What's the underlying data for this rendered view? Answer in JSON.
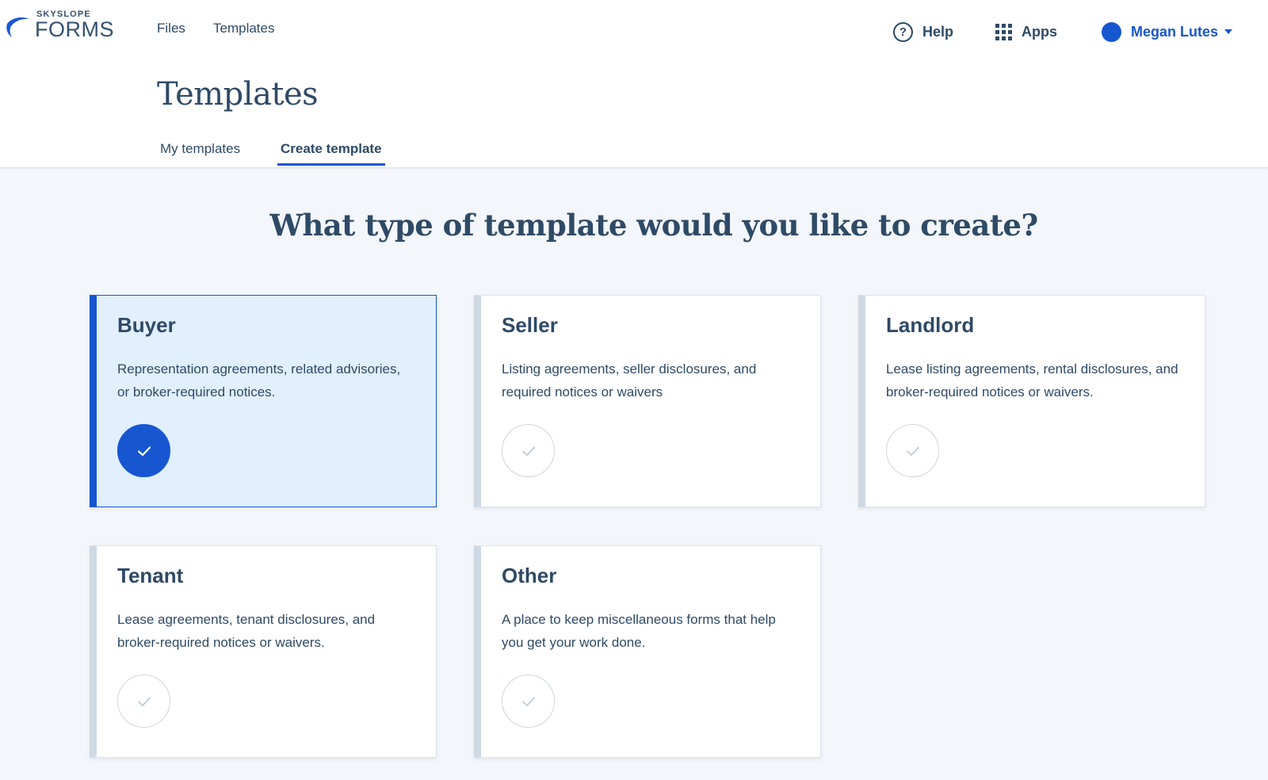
{
  "header": {
    "logo_small": "SKYSLOPE",
    "logo_big": "FORMS",
    "nav": [
      {
        "label": "Files"
      },
      {
        "label": "Templates"
      }
    ],
    "help_label": "Help",
    "apps_label": "Apps",
    "user_name": "Megan Lutes",
    "help_icon": "question-circle-icon",
    "apps_icon": "grid-icon"
  },
  "page": {
    "title": "Templates",
    "tabs": [
      {
        "label": "My templates",
        "active": false
      },
      {
        "label": "Create template",
        "active": true
      }
    ],
    "question": "What type of template would you like to create?"
  },
  "cards": [
    {
      "title": "Buyer",
      "description": "Representation agreements, related advisories, or broker-required notices.",
      "selected": true
    },
    {
      "title": "Seller",
      "description": "Listing agreements, seller disclosures, and required notices or waivers",
      "selected": false
    },
    {
      "title": "Landlord",
      "description": "Lease listing agreements, rental disclosures, and broker-required notices or waivers.",
      "selected": false
    },
    {
      "title": "Tenant",
      "description": "Lease agreements, tenant disclosures, and broker-required notices or waivers.",
      "selected": false
    },
    {
      "title": "Other",
      "description": "A place to keep miscellaneous forms that help you get your work done.",
      "selected": false
    }
  ],
  "colors": {
    "accent": "#1756d1",
    "text": "#2e4a66",
    "selected_bg": "#e1efff",
    "background": "#f3f6fa"
  }
}
